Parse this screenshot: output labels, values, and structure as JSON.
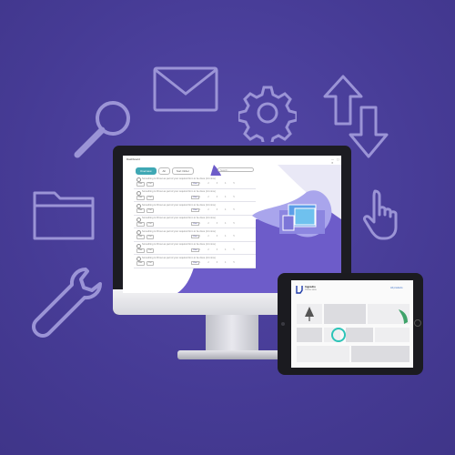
{
  "desktop_app": {
    "title": "Dashboard",
    "window_controls": "— ▢ ✕",
    "tabs": [
      "Overview",
      "All",
      "Sort Order"
    ],
    "search_placeholder": "Search...",
    "rows": [
      {
        "text": "Something to fill out as part of your required form to be done (14 mins)",
        "ctl": [
          "Edit",
          "Del"
        ],
        "link": "View",
        "nums": [
          "1",
          "2",
          "3",
          "4",
          "5"
        ]
      },
      {
        "text": "Something to fill out as part of your required form to be done (14 mins)",
        "ctl": [
          "Edit",
          "Del"
        ],
        "link": "View",
        "nums": [
          "1",
          "2",
          "3",
          "4",
          "5"
        ]
      },
      {
        "text": "Something to fill out as part of your required form to be done (14 mins)",
        "ctl": [
          "Edit",
          "Del"
        ],
        "link": "View",
        "nums": [
          "1",
          "2",
          "3",
          "4",
          "5"
        ]
      },
      {
        "text": "Something to fill out as part of your required form to be done (14 mins)",
        "ctl": [
          "Edit",
          "Del"
        ],
        "link": "View",
        "nums": [
          "1",
          "2",
          "3",
          "4",
          "5"
        ]
      },
      {
        "text": "Something to fill out as part of your required form to be done (14 mins)",
        "ctl": [
          "Edit",
          "Del"
        ],
        "link": "View",
        "nums": [
          "1",
          "2",
          "3",
          "4",
          "5"
        ]
      },
      {
        "text": "Something to fill out as part of your required form to be done (14 mins)",
        "ctl": [
          "Edit",
          "Del"
        ],
        "link": "View",
        "nums": [
          "1",
          "2",
          "3",
          "4",
          "5"
        ]
      },
      {
        "text": "Something to fill out as part of your required form to be done (14 mins)",
        "ctl": [
          "Edit",
          "Del"
        ],
        "link": "View",
        "nums": [
          "1",
          "2",
          "3",
          "4",
          "5"
        ]
      }
    ]
  },
  "tablet_app": {
    "brand": "Ingredio",
    "subtitle": "Online store",
    "link": "All products"
  },
  "decor_icons": [
    "envelope-icon",
    "gear-icon",
    "sync-arrows-icon",
    "search-icon",
    "folder-icon",
    "pointer-hand-icon",
    "wrench-icon"
  ],
  "colors": {
    "background": "#4a3f9a",
    "icon_stroke": "#9b94d6",
    "accent_teal": "#3fa8b4",
    "tablet_ring": "#2cc4b8"
  }
}
